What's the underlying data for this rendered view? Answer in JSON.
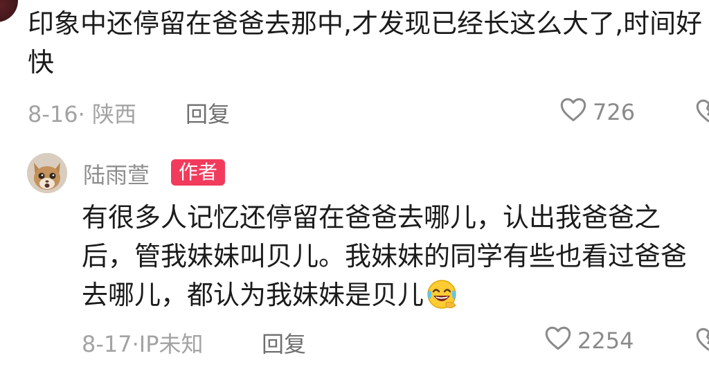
{
  "comment_top": {
    "text": "印象中还停留在爸爸去那中,才发现已经长这么大了,时间好快",
    "date_location": "8-16· 陕西",
    "reply_label": "回复",
    "like_count": "726"
  },
  "comment_reply": {
    "author": "陆雨萱",
    "author_badge": "作者",
    "text": "有很多人记忆还停留在爸爸去哪儿，认出我爸爸之后，管我妹妹叫贝儿。我妹妹的同学有些也看过爸爸去哪儿，都认为我妹妹是贝儿",
    "emoji": "laughing-tears-emoji",
    "date_location": "8-17·IP未知",
    "reply_label": "回复",
    "like_count": "2254"
  },
  "colors": {
    "badge": "#f23b5c",
    "text": "#1b1b1b",
    "meta": "#a3a3a3"
  }
}
